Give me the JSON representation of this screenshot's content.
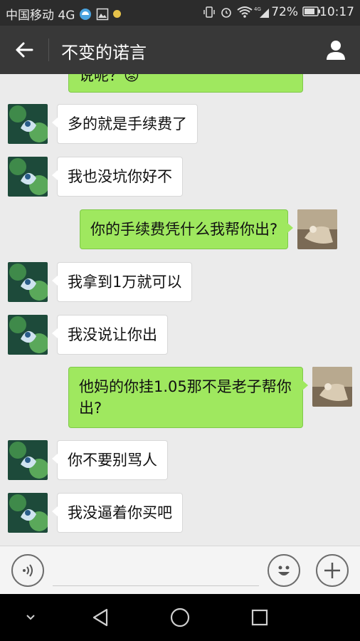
{
  "status_bar": {
    "carrier": "中国移动 4G",
    "battery": "72%",
    "time": "10:17",
    "icons": [
      "hd-icon",
      "image-icon",
      "dot-icon",
      "vibrate-icon",
      "alarm-icon",
      "wifi-icon",
      "signal-4g-icon",
      "battery-icon"
    ]
  },
  "header": {
    "title": "不变的诺言",
    "back_icon": "arrow-left-icon",
    "profile_icon": "person-icon"
  },
  "messages": [
    {
      "side": "out",
      "text": "说呢？😡",
      "partial": true
    },
    {
      "side": "in",
      "text": "多的就是手续费了"
    },
    {
      "side": "in",
      "text": "我也没坑你好不"
    },
    {
      "side": "out",
      "text": "你的手续费凭什么我帮你出?"
    },
    {
      "side": "in",
      "text": "我拿到1万就可以"
    },
    {
      "side": "in",
      "text": "我没说让你出"
    },
    {
      "side": "out",
      "text": "他妈的你挂1.05那不是老子帮你出?"
    },
    {
      "side": "in",
      "text": "你不要别骂人"
    },
    {
      "side": "in",
      "text": "我没逼着你买吧"
    }
  ],
  "input_bar": {
    "value": "",
    "icons": [
      "voice-icon",
      "emoji-icon",
      "plus-icon"
    ]
  },
  "nav_bar": {
    "icons": [
      "chevron-down-icon",
      "back-triangle-icon",
      "home-circle-icon",
      "recents-square-icon"
    ]
  },
  "colors": {
    "out_bubble": "#9fe85f",
    "in_bubble": "#ffffff",
    "header_bg": "#383838",
    "chat_bg": "#ebebeb"
  }
}
